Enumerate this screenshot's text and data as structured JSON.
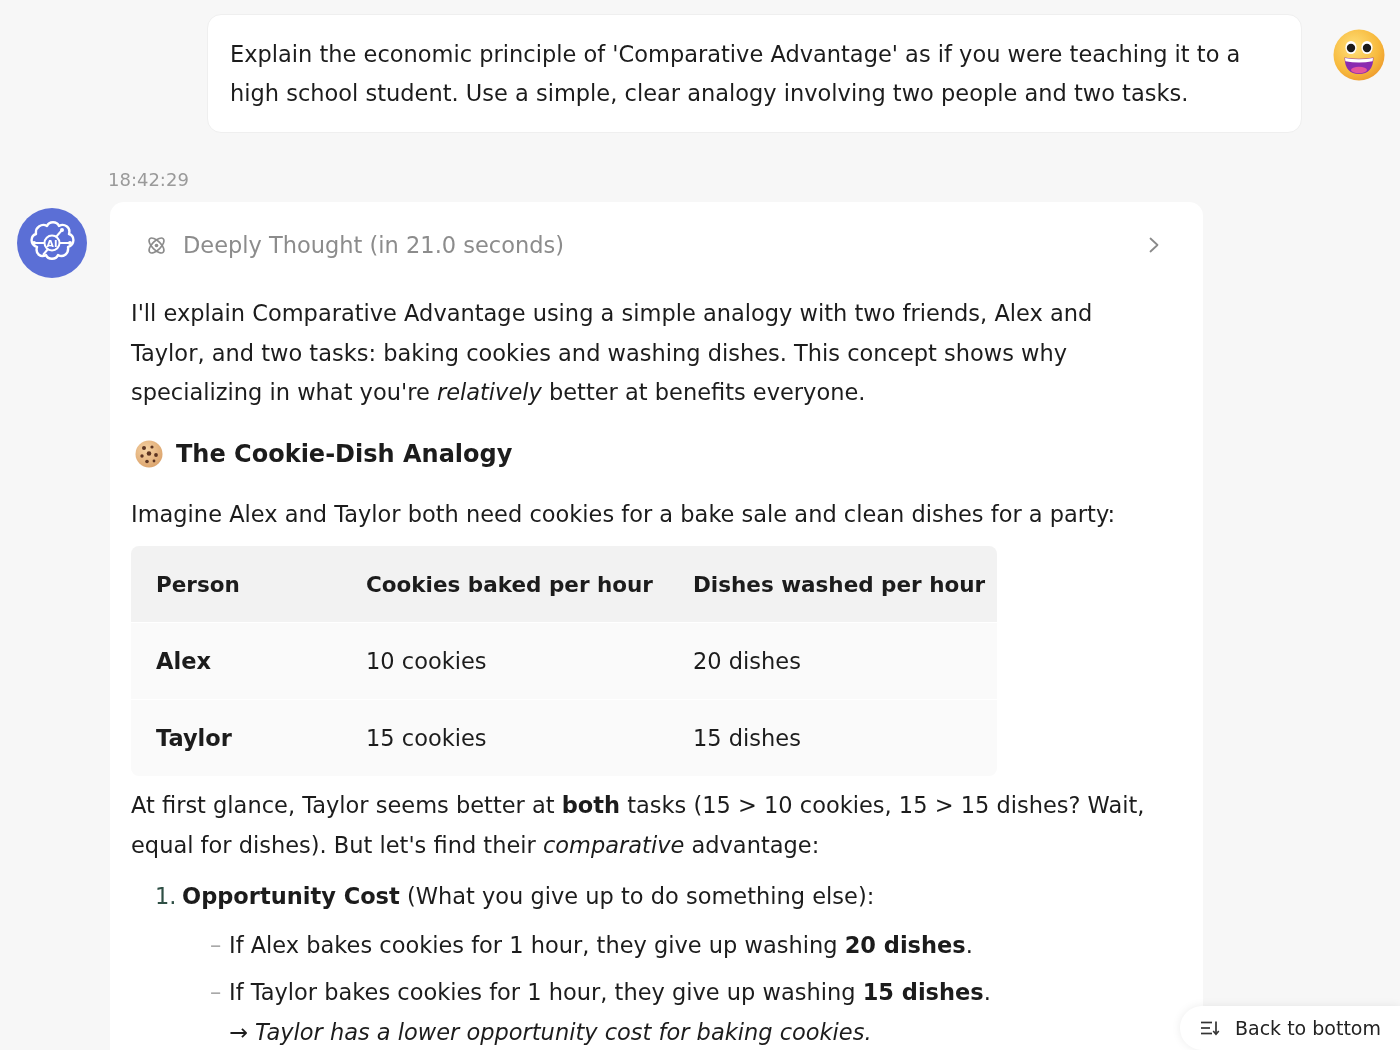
{
  "user_message": {
    "text": "Explain the economic principle of 'Comparative Advantage' as if you were teaching it to a high school student. Use a simple, clear analogy involving two people and two tasks."
  },
  "timestamp": "18:42:29",
  "assistant_message": {
    "avatar_label": "AI",
    "thinking": {
      "label": "Deeply Thought (in 21.0 seconds)",
      "expanded": false
    },
    "blocks": [
      {
        "kind": "paragraph",
        "text": "I'll explain Comparative Advantage using a simple analogy with two friends, Alex and Taylor, and two tasks: baking cookies and washing dishes. This concept shows why specializing in what you're *relatively* better at benefits everyone."
      },
      {
        "kind": "heading",
        "text": "The Cookie-Dish Analogy"
      },
      {
        "kind": "paragraph",
        "text": "Imagine Alex and Taylor both need cookies for a bake sale and clean dishes for a party:"
      },
      {
        "kind": "table",
        "columns": [
          "Person",
          "Cookies baked per hour",
          "Dishes washed per hour"
        ],
        "rows": [
          {
            "cells": [
              "Alex",
              "10 cookies",
              "20 dishes"
            ]
          },
          {
            "cells": [
              "Taylor",
              "15 cookies",
              "15 dishes"
            ]
          }
        ]
      },
      {
        "kind": "paragraph",
        "text": "At first glance, Taylor seems better at **both** tasks (15 > 10 cookies, 15 > 15 dishes? Wait, equal for dishes). But let's find their *comparative* advantage:"
      },
      {
        "kind": "ordered_list",
        "items": [
          {
            "marker": "1.",
            "text": "**Opportunity Cost** (What you give up to do something else):",
            "children": [
              {
                "marker": "–",
                "text": "If Alex bakes cookies for 1 hour, they give up washing **20 dishes**."
              },
              {
                "marker": "–",
                "text": "If Taylor bakes cookies for 1 hour, they give up washing **15 dishes**.",
                "note": "→ *Taylor has a lower opportunity cost for baking cookies.*"
              }
            ]
          }
        ]
      }
    ]
  },
  "back_to_bottom": {
    "label": "Back to bottom"
  }
}
